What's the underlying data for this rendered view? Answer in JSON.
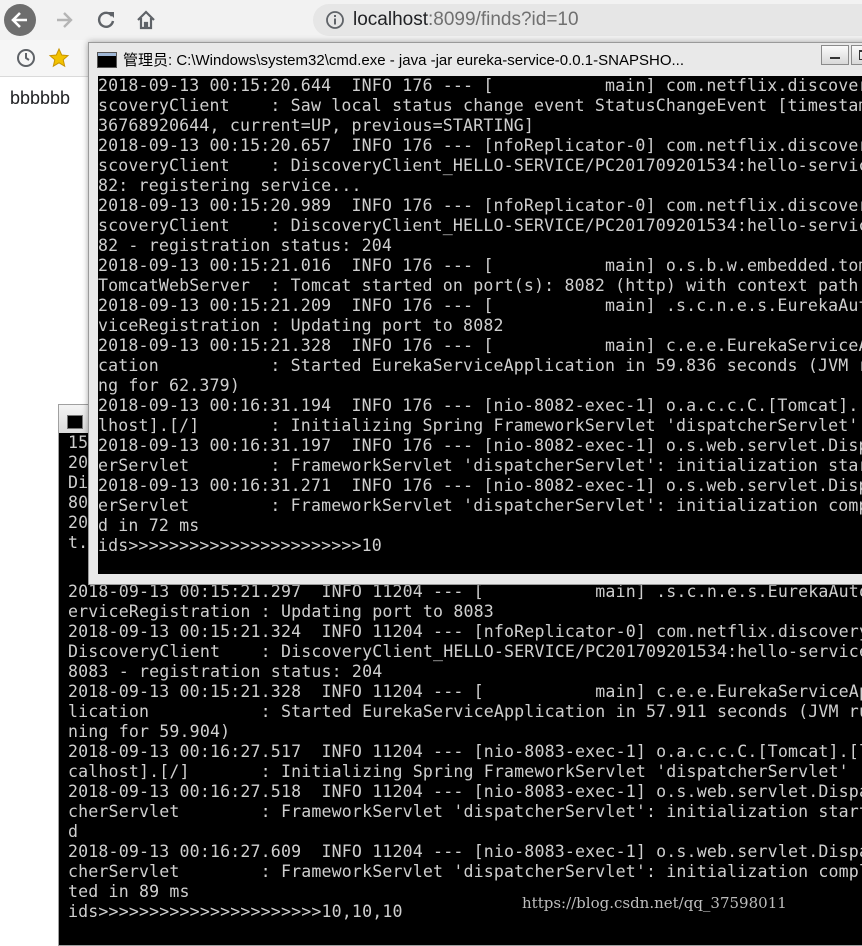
{
  "browser": {
    "url_host": "localhost",
    "url_rest": ":8099/finds?id=10",
    "icons": [
      "back-arrow-icon",
      "forward-arrow-icon",
      "reload-icon",
      "home-icon",
      "info-icon",
      "history-icon",
      "star-icon"
    ]
  },
  "page": {
    "body_text": "bbbbbb"
  },
  "front_console": {
    "title": "管理员: C:\\Windows\\system32\\cmd.exe - java  -jar eureka-service-0.0.1-SNAPSHO...",
    "lines": [
      "2018-09-13 00:15:20.644  INFO 176 --- [           main] com.netflix.discovery",
      "scoveryClient    : Saw local status change event StatusChangeEvent [timestamp",
      "36768920644, current=UP, previous=STARTING]",
      "2018-09-13 00:15:20.657  INFO 176 --- [nfoReplicator-0] com.netflix.discovery",
      "scoveryClient    : DiscoveryClient_HELLO-SERVICE/PC201709201534:hello-service",
      "82: registering service...",
      "2018-09-13 00:15:20.989  INFO 176 --- [nfoReplicator-0] com.netflix.discovery",
      "scoveryClient    : DiscoveryClient_HELLO-SERVICE/PC201709201534:hello-service",
      "82 - registration status: 204",
      "2018-09-13 00:15:21.016  INFO 176 --- [           main] o.s.b.w.embedded.tomc",
      "TomcatWebServer  : Tomcat started on port(s): 8082 (http) with context path",
      "2018-09-13 00:15:21.209  INFO 176 --- [           main] .s.c.n.e.s.EurekaAuto",
      "viceRegistration : Updating port to 8082",
      "2018-09-13 00:15:21.328  INFO 176 --- [           main] c.e.e.EurekaServiceAp",
      "cation           : Started EurekaServiceApplication in 59.836 seconds (JVM ru",
      "ng for 62.379)",
      "2018-09-13 00:16:31.194  INFO 176 --- [nio-8082-exec-1] o.a.c.c.C.[Tomcat].[",
      "lhost].[/]       : Initializing Spring FrameworkServlet 'dispatcherServlet'",
      "2018-09-13 00:16:31.197  INFO 176 --- [nio-8082-exec-1] o.s.web.servlet.Dispa",
      "erServlet        : FrameworkServlet 'dispatcherServlet': initialization start",
      "2018-09-13 00:16:31.271  INFO 176 --- [nio-8082-exec-1] o.s.web.servlet.Dispa",
      "erServlet        : FrameworkServlet 'dispatcherServlet': initialization compl",
      "d in 72 ms",
      "ids>>>>>>>>>>>>>>>>>>>>>>>10"
    ]
  },
  "back_console": {
    "left_strip": [
      "15",
      "20",
      "Di",
      "80",
      "20",
      "t."
    ],
    "lines": [
      "2018-09-13 00:15:21.297  INFO 11204 --- [           main] .s.c.n.e.s.EurekaAuto",
      "erviceRegistration : Updating port to 8083",
      "2018-09-13 00:15:21.324  INFO 11204 --- [nfoReplicator-0] com.netflix.discovery",
      "DiscoveryClient    : DiscoveryClient_HELLO-SERVICE/PC201709201534:hello-service",
      "8083 - registration status: 204",
      "2018-09-13 00:15:21.328  INFO 11204 --- [           main] c.e.e.EurekaServiceApp",
      "lication           : Started EurekaServiceApplication in 57.911 seconds (JVM run",
      "ning for 59.904)",
      "2018-09-13 00:16:27.517  INFO 11204 --- [nio-8083-exec-1] o.a.c.c.C.[Tomcat].[lo",
      "calhost].[/]       : Initializing Spring FrameworkServlet 'dispatcherServlet'",
      "2018-09-13 00:16:27.518  INFO 11204 --- [nio-8083-exec-1] o.s.web.servlet.Dispat",
      "cherServlet        : FrameworkServlet 'dispatcherServlet': initialization starte",
      "d",
      "2018-09-13 00:16:27.609  INFO 11204 --- [nio-8083-exec-1] o.s.web.servlet.Dispat",
      "cherServlet        : FrameworkServlet 'dispatcherServlet': initialization comple",
      "ted in 89 ms",
      "ids>>>>>>>>>>>>>>>>>>>>>>10,10,10"
    ]
  },
  "watermark": "https://blog.csdn.net/qq_37598011"
}
